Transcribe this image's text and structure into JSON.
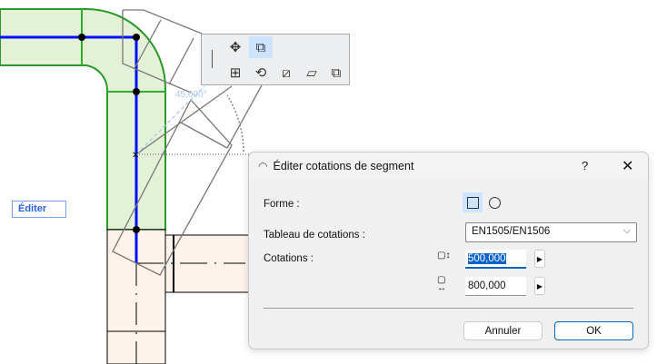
{
  "canvas": {
    "edit_label": "Éditer",
    "angle_label": "45,000°"
  },
  "toolbar": {
    "icons": [
      "move-icon",
      "elevation-icon",
      "drag-icon",
      "rotate-icon",
      "mirror-icon",
      "offset-icon",
      "multiply-icon"
    ]
  },
  "dialog": {
    "title": "Éditer cotations de segment",
    "help": "?",
    "close": "✕",
    "shape_label": "Forme :",
    "table_label": "Tableau de cotations :",
    "table_value": "EN1505/EN1506",
    "dims_label": "Cotations :",
    "height_value": "500,000",
    "width_value": "800,000",
    "cancel": "Annuler",
    "ok": "OK"
  }
}
